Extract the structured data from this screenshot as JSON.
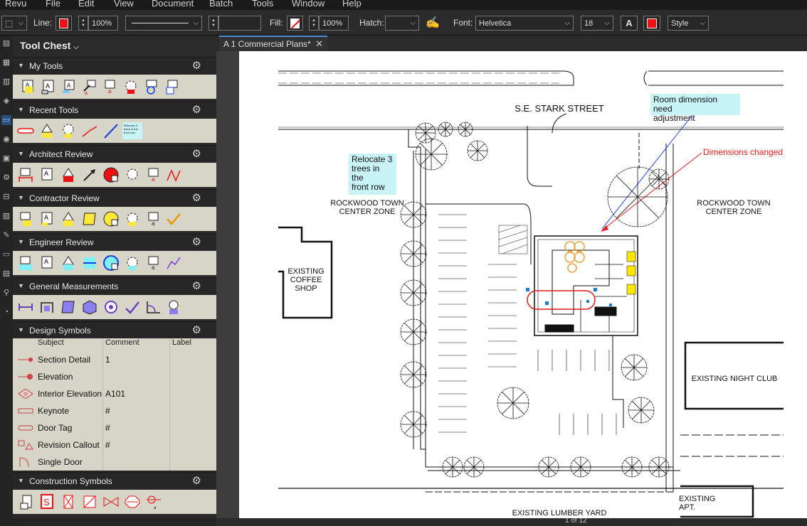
{
  "menu": [
    "Revu",
    "File",
    "Edit",
    "View",
    "Document",
    "Batch",
    "Tools",
    "Window",
    "Help"
  ],
  "toolbar": {
    "line_label": "Line:",
    "line_opacity": "100%",
    "fill_label": "Fill:",
    "fill_opacity": "100%",
    "hatch_label": "Hatch:",
    "font_label": "Font:",
    "font_value": "Helvetica",
    "font_size": "18",
    "style_label": "Style",
    "line_color": "#e21b1b",
    "text_color": "#e21b1b"
  },
  "sidebar": {
    "title": "Tool Chest",
    "sections": {
      "my_tools": "My Tools",
      "recent_tools": "Recent Tools",
      "architect_review": "Architect Review",
      "contractor_review": "Contractor Review",
      "engineer_review": "Engineer Review",
      "general_measurements": "General Measurements",
      "design_symbols": "Design Symbols",
      "construction_symbols": "Construction Symbols"
    },
    "recent_note": "Relocate 3 trees in the front row",
    "symbols_table": {
      "headers": [
        "Subject",
        "Comment",
        "Label"
      ],
      "rows": [
        {
          "subject": "Section Detail",
          "comment": "1"
        },
        {
          "subject": "Elevation",
          "comment": ""
        },
        {
          "subject": "Interior Elevation",
          "comment": "A101"
        },
        {
          "subject": "Keynote",
          "comment": "#"
        },
        {
          "subject": "Door Tag",
          "comment": "#"
        },
        {
          "subject": "Revision Callout",
          "comment": "#"
        },
        {
          "subject": "Single Door",
          "comment": ""
        }
      ]
    }
  },
  "tab": {
    "title": "A 1 Commercial Plans*"
  },
  "drawing": {
    "street_top": "S.E. STARK STREET",
    "zone_left": [
      "ROCKWOOD TOWN",
      "CENTER ZONE"
    ],
    "zone_right": [
      "ROCKWOOD TOWN",
      "CENTER ZONE"
    ],
    "coffee_shop": [
      "EXISTING",
      "COFFEE",
      "SHOP"
    ],
    "night_club": "EXISTING NIGHT CLUB",
    "lumber_yard": "EXISTING LUMBER YARD",
    "apt": [
      "EXISTING",
      "APT."
    ],
    "callout_trees": [
      "Relocate 3",
      "trees in the",
      "front row"
    ],
    "callout_room": [
      "Room dimension need",
      "adjustment"
    ],
    "callout_dims": "Dimensions changed"
  },
  "status": {
    "page": "1 of 12"
  },
  "colors": {
    "accent": "#4a90d9",
    "markup_red": "#e21b1b",
    "markup_blue": "#1a3fe0",
    "callout_bg": "#c8f4f8"
  }
}
